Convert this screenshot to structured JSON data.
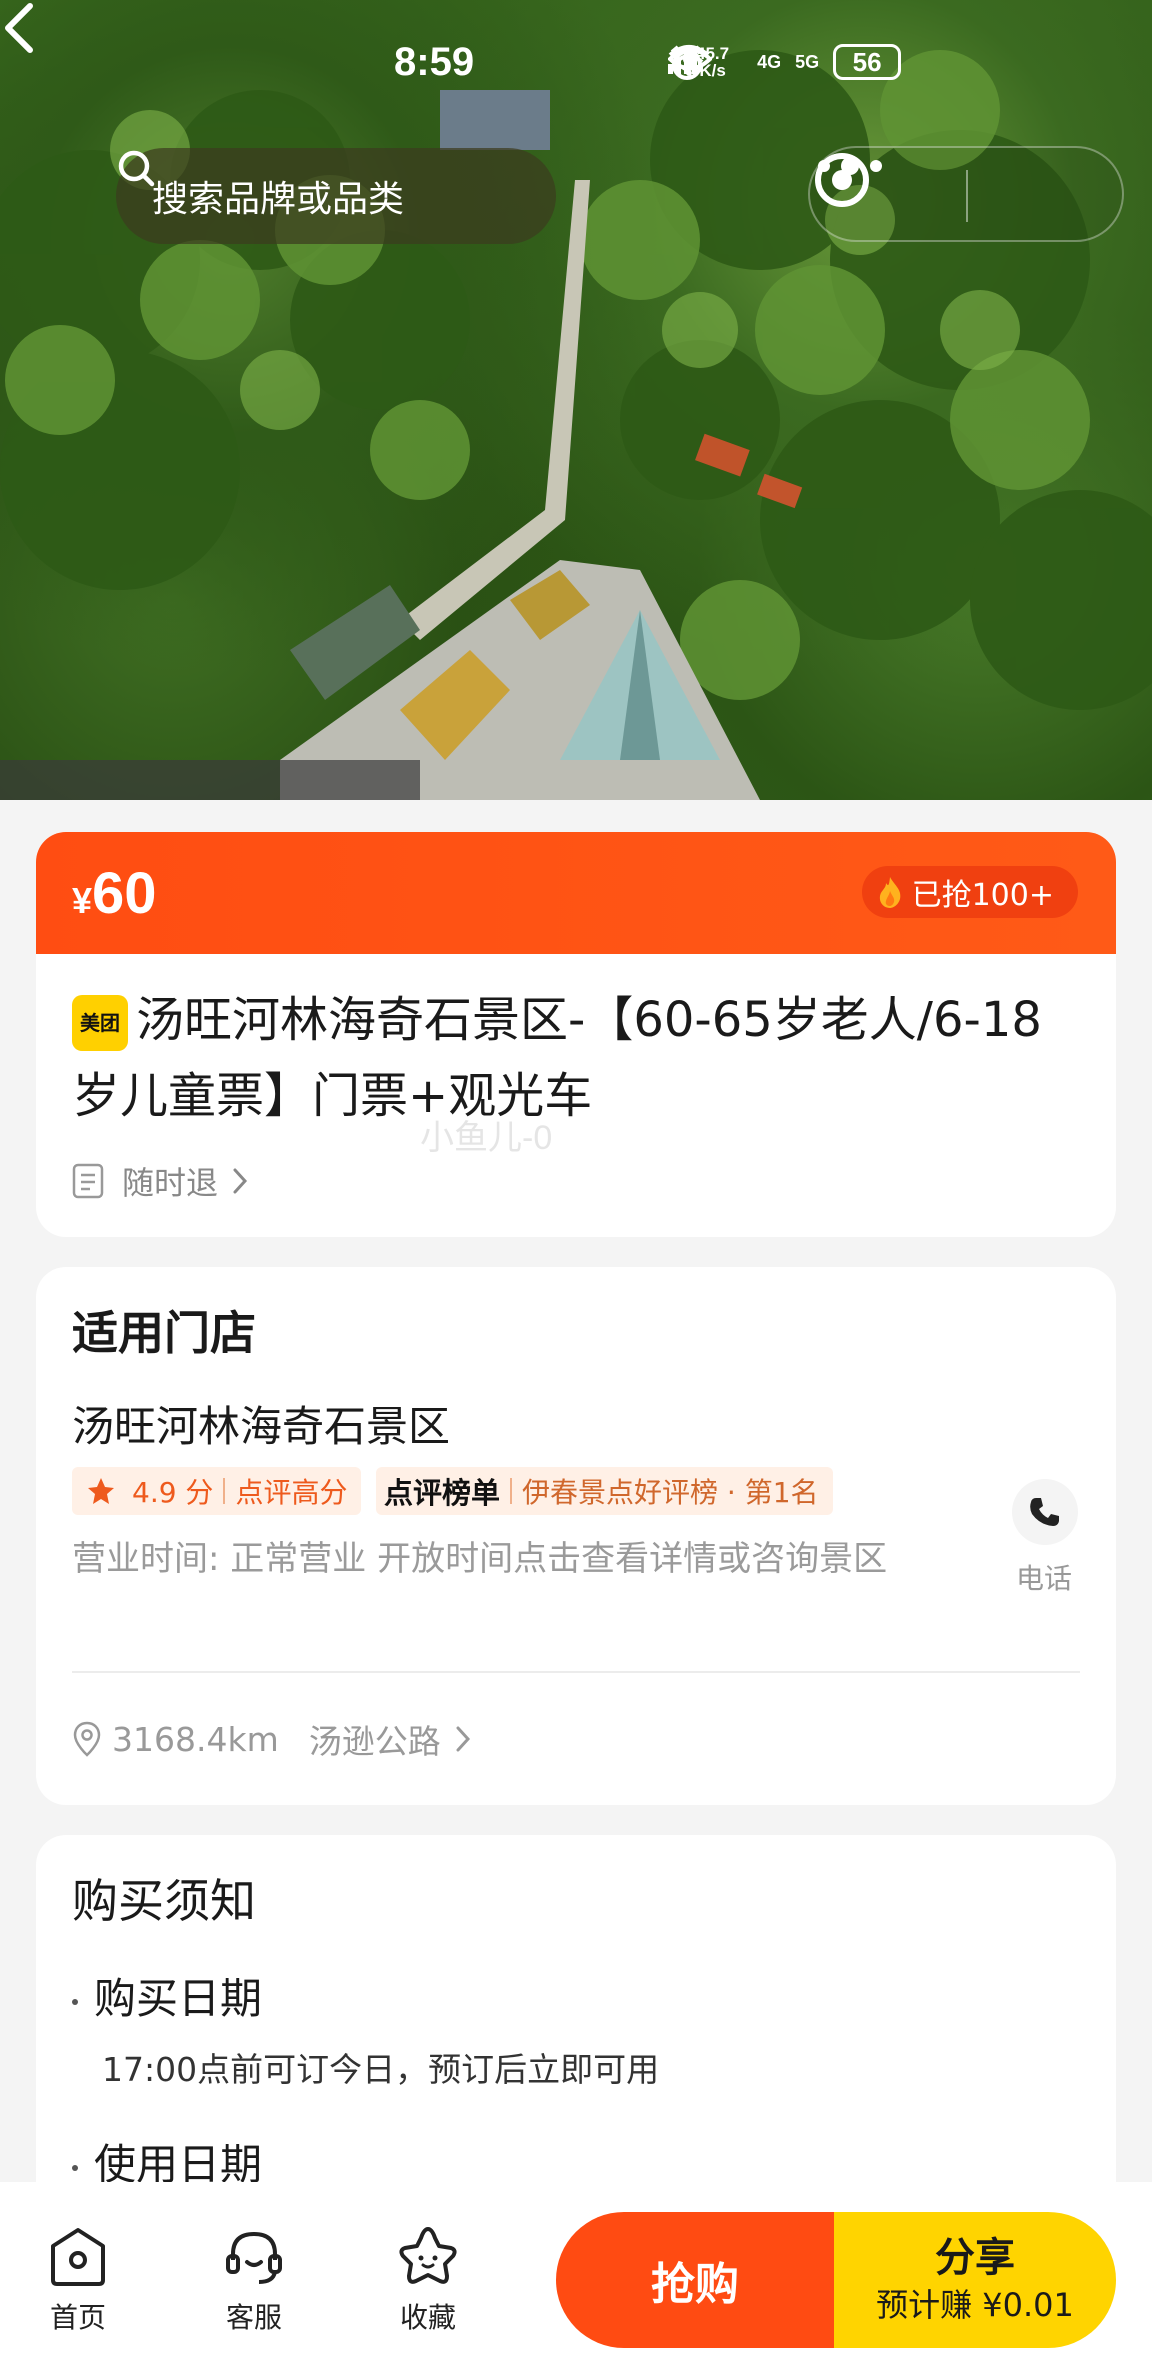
{
  "status_bar": {
    "time": "8:59",
    "net_speed_value": "45.7",
    "net_speed_unit": "K/s",
    "signal_1": "4G",
    "signal_2": "5G",
    "battery": "56",
    "icons": [
      "eye-icon",
      "alarm-icon",
      "wifi-icon",
      "signal-icon",
      "battery-icon"
    ]
  },
  "nav": {
    "search_placeholder": "搜索品牌或品类",
    "icons": [
      "back-arrow-icon",
      "search-icon",
      "more-dots-icon",
      "target-icon"
    ]
  },
  "hero": {
    "image": "aerial-forest-photo"
  },
  "deal": {
    "currency": "¥",
    "price": "60",
    "sold_badge": "已抢100+",
    "brand_badge": "美团",
    "title": "汤旺河林海奇石景区-【60-65岁老人/6-18岁儿童票】门票+观光车",
    "refund_policy": "随时退",
    "watermark": "小鱼儿-0"
  },
  "store": {
    "section_title": "适用门店",
    "name": "汤旺河林海奇石景区",
    "rating": "4.9 分",
    "rating_tag": "点评高分",
    "rank_brand": "点评榜单",
    "rank_text": "伊春景点好评榜 · 第1名",
    "hours": "营业时间:  正常营业 开放时间点击查看详情或咨询景区",
    "phone_label": "电话",
    "distance": "3168.4km",
    "address": "汤逊公路"
  },
  "notice": {
    "section_title": "购买须知",
    "items": [
      {
        "title": "购买日期",
        "text": "17:00点前可订今日，预订后立即可用"
      },
      {
        "title": "使用日期",
        "text": ""
      }
    ]
  },
  "bottom_bar": {
    "tabs": [
      {
        "label": "首页",
        "icon": "home-icon"
      },
      {
        "label": "客服",
        "icon": "headset-icon"
      },
      {
        "label": "收藏",
        "icon": "star-outline-icon"
      }
    ],
    "buy_label": "抢购",
    "share_label": "分享",
    "share_earn": "预计赚 ¥0.01"
  },
  "colors": {
    "accent_orange": "#ff4b12",
    "accent_yellow": "#ffd400",
    "brand_yellow": "#ffd000"
  }
}
